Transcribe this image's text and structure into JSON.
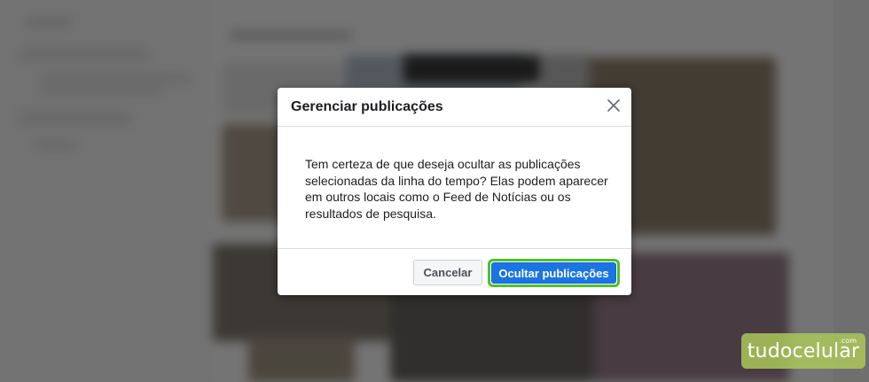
{
  "dialog": {
    "title": "Gerenciar publicações",
    "message": "Tem certeza de que deseja ocultar as publicações selecionadas da linha do tempo? Elas podem aparecer em outros locais como o Feed de Notícias ou os resultados de pesquisa.",
    "cancel_label": "Cancelar",
    "confirm_label": "Ocultar publicações",
    "close_icon": "close-icon"
  },
  "watermark": {
    "brand": "tudocelular",
    "suffix": ".com"
  },
  "colors": {
    "primary": "#1b74e4",
    "highlight_ring": "#4cc22e",
    "watermark": "#aac85a"
  }
}
